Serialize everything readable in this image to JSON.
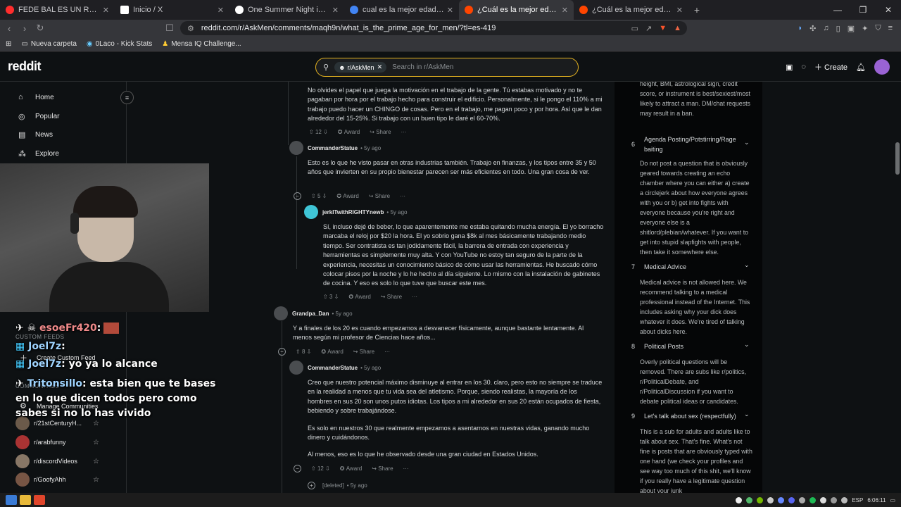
{
  "browser": {
    "tabs": [
      {
        "title": "FEDE BAL ES UN RANCIOVICH? Me D",
        "favicon_color": "#ff2d2d"
      },
      {
        "title": "Inicio / X",
        "favicon_color": "#ffffff"
      },
      {
        "title": "One Summer Night in NYC | TikTok",
        "favicon_color": "#ffffff"
      },
      {
        "title": "cual es la mejor edad en un hombre",
        "favicon_color": "#4285f4"
      },
      {
        "title": "¿Cuál es la mejor edad para los h",
        "favicon_color": "#ff4500"
      },
      {
        "title": "¿Cuál es la mejor edad para los homb",
        "favicon_color": "#ff4500"
      }
    ],
    "url": "reddit.com/r/AskMen/comments/maqh9n/what_is_the_prime_age_for_men/?tl=es-419",
    "bookmarks": [
      "Nueva carpeta",
      "0Laco - Kick Stats",
      "Mensa IQ Challenge..."
    ]
  },
  "reddit": {
    "logo": "reddit",
    "search_chip": "r/AskMen",
    "search_placeholder": "Search in r/AskMen",
    "create_label": "Create"
  },
  "sidebar": {
    "nav": [
      "Home",
      "Popular",
      "News",
      "Explore"
    ],
    "custom_feeds_label": "CUSTOM FEEDS",
    "create_custom_feed": "Create Custom Feed",
    "communities_label": "COMMUNITIES",
    "manage_communities": "Manage Communities",
    "communities": [
      "r/21stCenturyH...",
      "r/arabfunny",
      "r/discordVideos",
      "r/GoofyAhh"
    ]
  },
  "stream_chat": [
    {
      "name": "esoeFr420",
      "text": ""
    },
    {
      "name": "Joel7z",
      "text": ""
    },
    {
      "name": "Joel7z",
      "text": "yo ya lo alcance"
    },
    {
      "name": "Tritonsillo",
      "text": "esta bien que te bases en lo que dicen todos pero como sabes si no lo has vivido"
    }
  ],
  "comments": [
    {
      "id": "c0",
      "user": "",
      "age": "",
      "text": "No olvides el papel que juega la motivación en el trabajo de la gente. Tú estabas motivado y no te pagaban por hora por el trabajo hecho para construir el edificio. Personalmente, si le pongo el 110% a mi trabajo puedo hacer un CHINGO de cosas. Pero en el trabajo, me pagan poco y por hora. Así que le dan alrededor del 15-25%. Si trabajo con un buen tipo le daré el 60-70%.",
      "votes": "12"
    },
    {
      "id": "c1",
      "user": "CommanderStatue",
      "age": "5y ago",
      "text": "Esto es lo que he visto pasar en otras industrias también. Trabajo en finanzas, y los tipos entre 35 y 50 años que invierten en su propio bienestar parecen ser más eficientes en todo. Una gran cosa de ver.",
      "votes": "5"
    },
    {
      "id": "c2",
      "user": "jerkITwithRIGHTYnewb",
      "age": "5y ago",
      "text": "Sí, incluso dejé de beber, lo que aparentemente me estaba quitando mucha energía. El yo borracho marcaba el reloj por $20 la hora. El yo sobrio gana $8k al mes básicamente trabajando medio tiempo. Ser contratista es tan jodidamente fácil, la barrera de entrada con experiencia y herramientas es simplemente muy alta. Y con YouTube no estoy tan seguro de la parte de la experiencia, necesitas un conocimiento básico de cómo usar las herramientas. He buscado cómo colocar pisos por la noche y lo he hecho al día siguiente. Lo mismo con la instalación de gabinetes de cocina. Y eso es solo lo que tuve que buscar este mes.",
      "votes": "3"
    },
    {
      "id": "c3",
      "user": "Grandpa_Dan",
      "age": "5y ago",
      "text": "Y a finales de los 20 es cuando empezamos a desvanecer físicamente, aunque bastante lentamente. Al menos según mi profesor de Ciencias hace años...",
      "votes": "8"
    },
    {
      "id": "c4",
      "user": "CommanderStatue",
      "age": "5y ago",
      "text": "Creo que nuestro potencial máximo disminuye al entrar en los 30. claro, pero esto no siempre se traduce en la realidad a menos que tu vida sea del atletismo. Porque, siendo realistas, la mayoría de los hombres en sus 20 son unos putos idiotas. Los tipos a mi alrededor en sus 20 están ocupados de fiesta, bebiendo y sobre trabajándose.",
      "text2": "Es solo en nuestros 30 que realmente empezamos a asentarnos en nuestras vidas, ganando mucho dinero y cuidándonos.",
      "text3": "Al menos, eso es lo que he observado desde una gran ciudad en Estados Unidos.",
      "votes": "12"
    },
    {
      "id": "c5",
      "user": "[deleted]",
      "age": "5y ago"
    }
  ],
  "actions": {
    "award": "Award",
    "share": "Share",
    "more": "···"
  },
  "rules": {
    "r5_tail": "height, BMI, astrological sign, credit score, or instrument is best/sexiest/most likely to attract a man. DM/chat requests may result in a ban.",
    "items": [
      {
        "num": "6",
        "title": "Agenda Posting/Potstirring/Rage baiting",
        "text": "Do not post a question that is obviously geared towards creating an echo chamber where you can either a) create a circlejerk about how everyone agrees with you or b) get into fights with everyone because you're right and everyone else is a shitlord/plebian/whatever. If you want to get into stupid slapfights with people, then take it somewhere else."
      },
      {
        "num": "7",
        "title": "Medical Advice",
        "text": "Medical advice is not allowed here. We recommend talking to a medical professional instead of the Internet. This includes asking why your dick does whatever it does. We're tired of talking about dicks here."
      },
      {
        "num": "8",
        "title": "Political Posts",
        "text": "Overly political questions will be removed. There are subs like r/politics, r/PoliticalDebate, and r/PoliticalDiscussion if you want to debate political ideas or candidates."
      },
      {
        "num": "9",
        "title": "Let's talk about sex (respectfully)",
        "text": "This is a sub for adults and adults like to talk about sex. That's fine. What's not fine is posts that are obviously typed with one hand (we check your profiles and see way too much of this shit, we'll know if you really have a legitimate question about your junk"
      }
    ]
  },
  "taskbar": {
    "lang": "ESP",
    "time": "6:06:11"
  }
}
